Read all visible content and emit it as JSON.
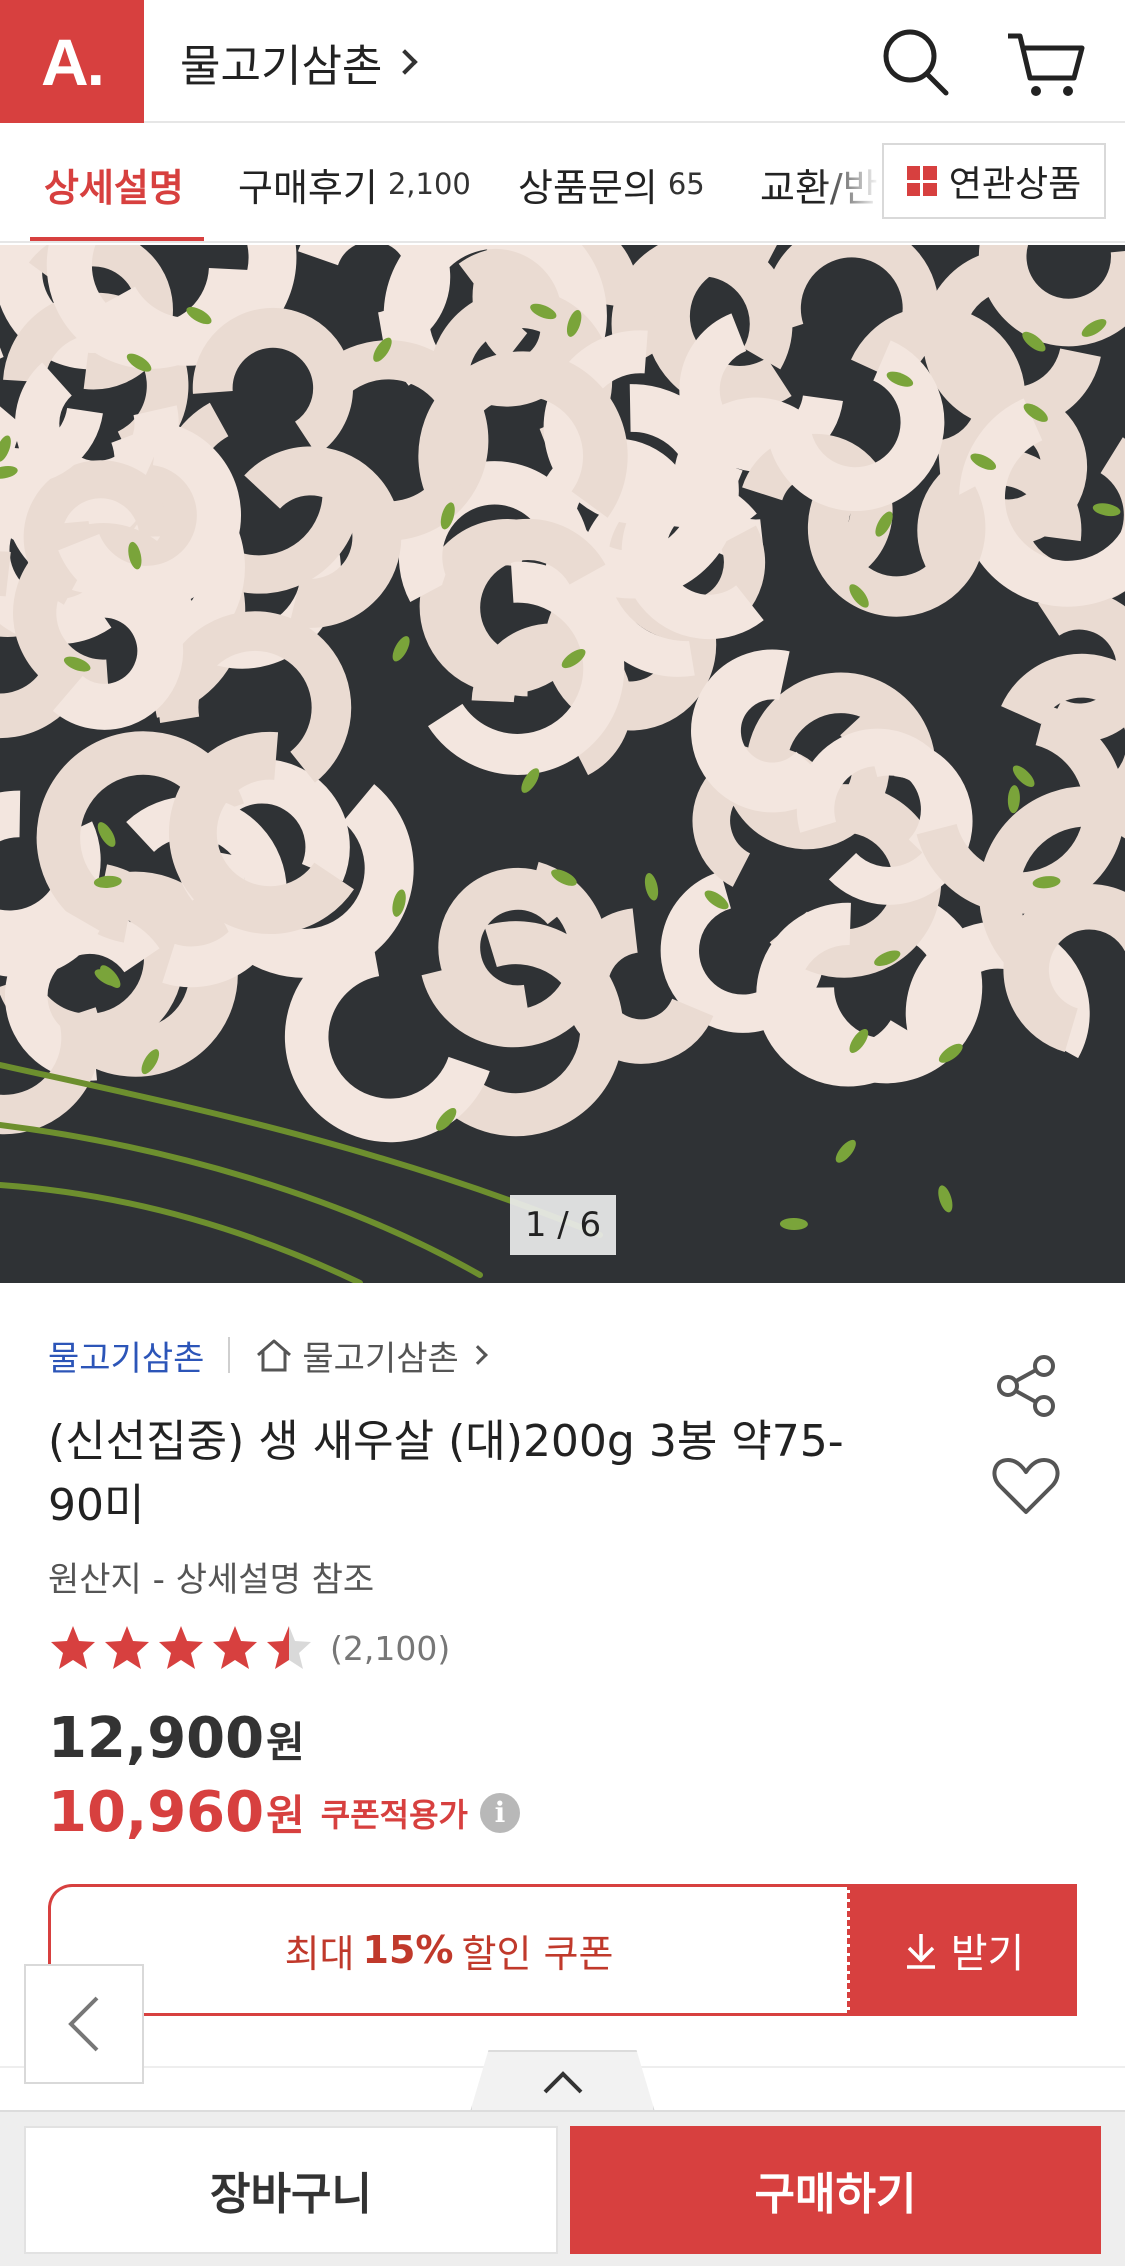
{
  "header": {
    "logo_text": "A.",
    "store_title": "물고기삼촌",
    "search_icon": "search-icon",
    "cart_icon": "cart-icon",
    "accent_color": "#d7403f"
  },
  "tabs": [
    {
      "label": "상세설명",
      "count": "",
      "active": true
    },
    {
      "label": "구매후기",
      "count": "2,100",
      "active": false
    },
    {
      "label": "상품문의",
      "count": "65",
      "active": false
    },
    {
      "label": "교환/반",
      "count": "",
      "active": false
    }
  ],
  "related_button": {
    "label": "연관상품",
    "icon": "grid-icon"
  },
  "gallery": {
    "counter": "1 / 6"
  },
  "product": {
    "seller": "물고기삼촌",
    "home_store": "물고기삼촌",
    "name": "(신선집중) 생 새우살 (대)200g 3봉 약75-90미",
    "origin": "원산지 - 상세설명 참조",
    "rating_value": 4.5,
    "rating_max": 5,
    "review_count": "(2,100)",
    "original_price": "12,900",
    "sale_price": "10,960",
    "currency": "원",
    "coupon_price_label": "쿠폰적용가",
    "info_icon": "i"
  },
  "coupon": {
    "prefix": "최대",
    "percent": "15%",
    "suffix": "할인 쿠폰",
    "get_label": "받기"
  },
  "bottom": {
    "cart_label": "장바구니",
    "buy_label": "구매하기"
  }
}
